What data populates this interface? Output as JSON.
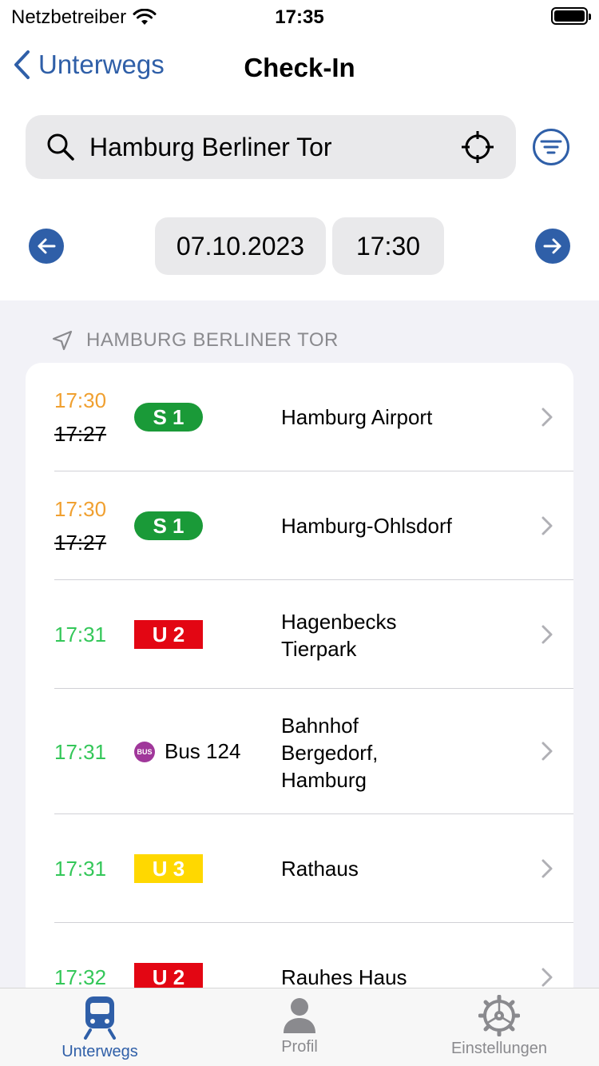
{
  "status_bar": {
    "carrier": "Netzbetreiber",
    "time": "17:35"
  },
  "nav": {
    "back_label": "Unterwegs",
    "title": "Check-In"
  },
  "search": {
    "value": "Hamburg Berliner Tor"
  },
  "date_row": {
    "date": "07.10.2023",
    "time": "17:30"
  },
  "section": {
    "title": "HAMBURG BERLINER TOR"
  },
  "departures": [
    {
      "time": "17:30",
      "old_time": "17:27",
      "line": "S 1",
      "destination": "Hamburg Airport"
    },
    {
      "time": "17:30",
      "old_time": "17:27",
      "line": "S 1",
      "destination": "Hamburg-Ohlsdorf"
    },
    {
      "time": "17:31",
      "line": "U 2",
      "destination_lines": [
        "Hagenbecks",
        "Tierpark"
      ]
    },
    {
      "time": "17:31",
      "line": "Bus 124",
      "bus_icon_text": "BUS",
      "destination_lines": [
        "Bahnhof",
        "Bergedorf,",
        "Hamburg"
      ]
    },
    {
      "time": "17:31",
      "line": "U 3",
      "destination": "Rathaus"
    },
    {
      "time": "17:32",
      "line": "U 2",
      "destination": "Rauhes Haus"
    }
  ],
  "colors": {
    "accent": "#2f5fa8",
    "delayed": "#f0a030",
    "on_time": "#34c759",
    "s_bahn": "#1a9a38",
    "u2": "#e30613",
    "u3": "#ffd800",
    "bus": "#a0379a"
  },
  "tabs": [
    {
      "label": "Unterwegs",
      "icon": "train-icon",
      "active": true
    },
    {
      "label": "Profil",
      "icon": "person-icon",
      "active": false
    },
    {
      "label": "Einstellungen",
      "icon": "gear-icon",
      "active": false
    }
  ]
}
